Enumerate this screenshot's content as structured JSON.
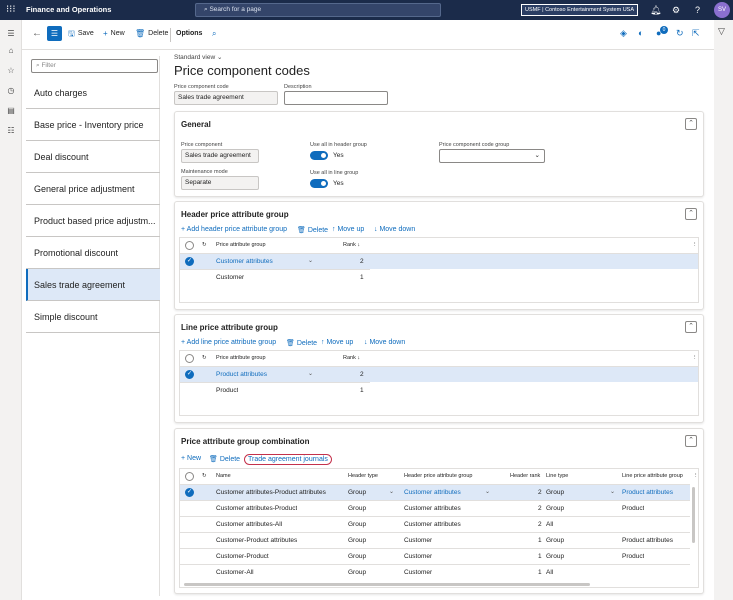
{
  "topbar": {
    "app_title": "Finance and Operations",
    "search_placeholder": "Search for a page",
    "company": "USMF | Contoso Entertainment System USA",
    "avatar": "SV"
  },
  "actions": {
    "save": "Save",
    "new": "New",
    "delete": "Delete",
    "options": "Options"
  },
  "list": {
    "filter_placeholder": "Filter",
    "items": [
      "Auto charges",
      "Base price - Inventory price",
      "Deal discount",
      "General price adjustment",
      "Product based price adjustm...",
      "Promotional discount",
      "Sales trade agreement",
      "Simple discount"
    ],
    "selected": "Sales trade agreement"
  },
  "form": {
    "view": "Standard view",
    "title": "Price component codes",
    "code_label": "Price component code",
    "code_value": "Sales trade agreement",
    "desc_label": "Description",
    "desc_value": ""
  },
  "general": {
    "title": "General",
    "price_component_label": "Price component",
    "price_component_value": "Sales trade agreement",
    "maint_label": "Maintenance mode",
    "maint_value": "Separate",
    "use_header_label": "Use all in header group",
    "use_header_value": "Yes",
    "use_line_label": "Use all in line group",
    "use_line_value": "Yes",
    "code_group_label": "Price component code group",
    "code_group_value": ""
  },
  "header_group": {
    "title": "Header price attribute group",
    "add": "Add header price attribute group",
    "delete": "Delete",
    "move_up": "Move up",
    "move_down": "Move down",
    "col_group": "Price attribute group",
    "col_rank": "Rank",
    "rows": [
      {
        "group": "Customer attributes",
        "rank": "2"
      },
      {
        "group": "Customer",
        "rank": "1"
      }
    ]
  },
  "line_group": {
    "title": "Line price attribute group",
    "add": "Add line price attribute group",
    "delete": "Delete",
    "move_up": "Move up",
    "move_down": "Move down",
    "col_group": "Price attribute group",
    "col_rank": "Rank",
    "rows": [
      {
        "group": "Product attributes",
        "rank": "2"
      },
      {
        "group": "Product",
        "rank": "1"
      }
    ]
  },
  "combination": {
    "title": "Price attribute group combination",
    "new": "New",
    "delete": "Delete",
    "journals": "Trade agreement journals",
    "cols": [
      "Name",
      "Header type",
      "Header price attribute group",
      "Header rank",
      "Line type",
      "Line price attribute group"
    ],
    "rows": [
      {
        "name": "Customer attributes-Product attributes",
        "htype": "Group",
        "hgroup": "Customer attributes",
        "hrank": "2",
        "ltype": "Group",
        "lgroup": "Product attributes"
      },
      {
        "name": "Customer attributes-Product",
        "htype": "Group",
        "hgroup": "Customer attributes",
        "hrank": "2",
        "ltype": "Group",
        "lgroup": "Product"
      },
      {
        "name": "Customer attributes-All",
        "htype": "Group",
        "hgroup": "Customer attributes",
        "hrank": "2",
        "ltype": "All",
        "lgroup": ""
      },
      {
        "name": "Customer-Product attributes",
        "htype": "Group",
        "hgroup": "Customer",
        "hrank": "1",
        "ltype": "Group",
        "lgroup": "Product attributes"
      },
      {
        "name": "Customer-Product",
        "htype": "Group",
        "hgroup": "Customer",
        "hrank": "1",
        "ltype": "Group",
        "lgroup": "Product"
      },
      {
        "name": "Customer-All",
        "htype": "Group",
        "hgroup": "Customer",
        "hrank": "1",
        "ltype": "All",
        "lgroup": ""
      }
    ]
  },
  "colors": {
    "accent": "#0f6cbd",
    "topbar": "#1b2b4a",
    "highlight": "#c4314b"
  }
}
